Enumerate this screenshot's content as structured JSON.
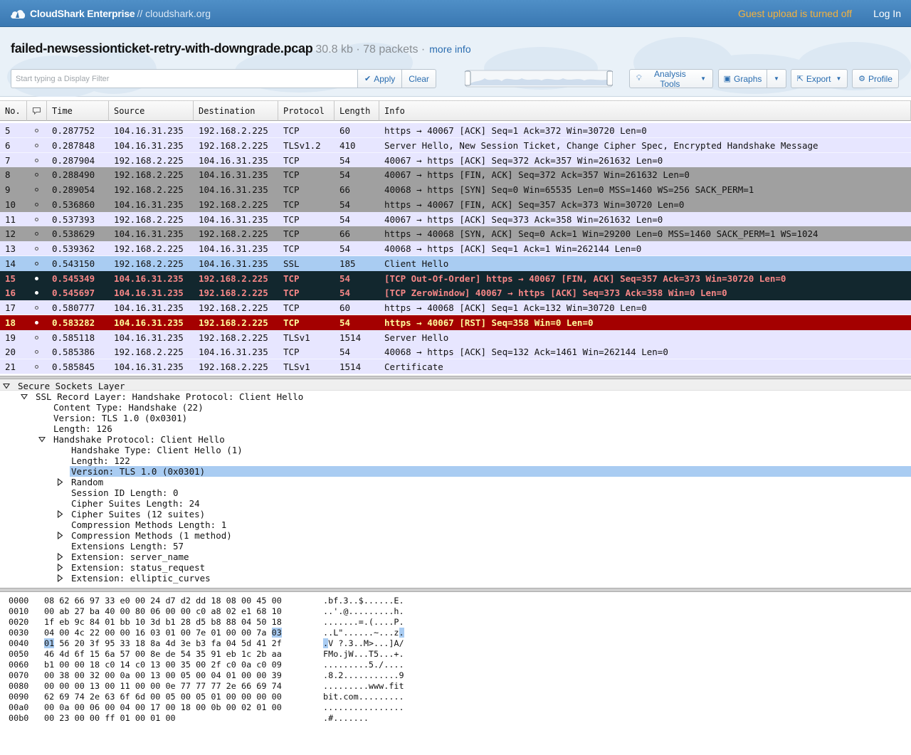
{
  "topnav": {
    "brand_name": "CloudShark Enterprise",
    "brand_suffix": "// cloudshark.org",
    "guest_note": "Guest upload is turned off",
    "login": "Log In",
    "logo_icon": "shark-cloud-icon",
    "accent_color": "#f4b23e"
  },
  "file": {
    "name": "failed-newsessionticket-retry-with-downgrade.pcap",
    "meta": "30.8 kb · 78 packets ·",
    "more_info": "more info"
  },
  "filter": {
    "placeholder": "Start typing a Display Filter",
    "value": "",
    "apply_label": "Apply",
    "clear_label": "Clear"
  },
  "tools": {
    "analysis_label": "Analysis Tools",
    "graphs_label": "Graphs",
    "export_label": "Export",
    "profile_label": "Profile"
  },
  "packet_list": {
    "columns": [
      "No.",
      "",
      "Time",
      "Source",
      "Destination",
      "Protocol",
      "Length",
      "Info"
    ],
    "rows": [
      {
        "no": "5",
        "time": "0.287752",
        "src": "104.16.31.235",
        "dst": "192.168.2.225",
        "proto": "TCP",
        "len": "60",
        "info": "https → 40067 [ACK] Seq=1 Ack=372 Win=30720 Len=0",
        "style": "tcp"
      },
      {
        "no": "6",
        "time": "0.287848",
        "src": "104.16.31.235",
        "dst": "192.168.2.225",
        "proto": "TLSv1.2",
        "len": "410",
        "info": "Server Hello, New Session Ticket, Change Cipher Spec, Encrypted Handshake Message",
        "style": "tcp"
      },
      {
        "no": "7",
        "time": "0.287904",
        "src": "192.168.2.225",
        "dst": "104.16.31.235",
        "proto": "TCP",
        "len": "54",
        "info": "40067 → https [ACK] Seq=372 Ack=357 Win=261632 Len=0",
        "style": "tcp"
      },
      {
        "no": "8",
        "time": "0.288490",
        "src": "192.168.2.225",
        "dst": "104.16.31.235",
        "proto": "TCP",
        "len": "54",
        "info": "40067 → https [FIN, ACK] Seq=372 Ack=357 Win=261632 Len=0",
        "style": "synfin"
      },
      {
        "no": "9",
        "time": "0.289054",
        "src": "192.168.2.225",
        "dst": "104.16.31.235",
        "proto": "TCP",
        "len": "66",
        "info": "40068 → https [SYN] Seq=0 Win=65535 Len=0 MSS=1460 WS=256 SACK_PERM=1",
        "style": "synfin"
      },
      {
        "no": "10",
        "time": "0.536860",
        "src": "104.16.31.235",
        "dst": "192.168.2.225",
        "proto": "TCP",
        "len": "54",
        "info": "https → 40067 [FIN, ACK] Seq=357 Ack=373 Win=30720 Len=0",
        "style": "synfin"
      },
      {
        "no": "11",
        "time": "0.537393",
        "src": "192.168.2.225",
        "dst": "104.16.31.235",
        "proto": "TCP",
        "len": "54",
        "info": "40067 → https [ACK] Seq=373 Ack=358 Win=261632 Len=0",
        "style": "tcp"
      },
      {
        "no": "12",
        "time": "0.538629",
        "src": "104.16.31.235",
        "dst": "192.168.2.225",
        "proto": "TCP",
        "len": "66",
        "info": "https → 40068 [SYN, ACK] Seq=0 Ack=1 Win=29200 Len=0 MSS=1460 SACK_PERM=1 WS=1024",
        "style": "synfin"
      },
      {
        "no": "13",
        "time": "0.539362",
        "src": "192.168.2.225",
        "dst": "104.16.31.235",
        "proto": "TCP",
        "len": "54",
        "info": "40068 → https [ACK] Seq=1 Ack=1 Win=262144 Len=0",
        "style": "tcp"
      },
      {
        "no": "14",
        "time": "0.543150",
        "src": "192.168.2.225",
        "dst": "104.16.31.235",
        "proto": "SSL",
        "len": "185",
        "info": "Client Hello",
        "style": "selected"
      },
      {
        "no": "15",
        "time": "0.545349",
        "src": "104.16.31.235",
        "dst": "192.168.2.225",
        "proto": "TCP",
        "len": "54",
        "info": "[TCP Out-Of-Order] https → 40067 [FIN, ACK] Seq=357 Ack=373 Win=30720 Len=0",
        "style": "bad"
      },
      {
        "no": "16",
        "time": "0.545697",
        "src": "104.16.31.235",
        "dst": "192.168.2.225",
        "proto": "TCP",
        "len": "54",
        "info": "[TCP ZeroWindow] 40067 → https [ACK] Seq=373 Ack=358 Win=0 Len=0",
        "style": "bad"
      },
      {
        "no": "17",
        "time": "0.580777",
        "src": "104.16.31.235",
        "dst": "192.168.2.225",
        "proto": "TCP",
        "len": "60",
        "info": "https → 40068 [ACK] Seq=1 Ack=132 Win=30720 Len=0",
        "style": "tcp"
      },
      {
        "no": "18",
        "time": "0.583282",
        "src": "104.16.31.235",
        "dst": "192.168.2.225",
        "proto": "TCP",
        "len": "54",
        "info": "https → 40067 [RST] Seq=358 Win=0 Len=0",
        "style": "rst"
      },
      {
        "no": "19",
        "time": "0.585118",
        "src": "104.16.31.235",
        "dst": "192.168.2.225",
        "proto": "TLSv1",
        "len": "1514",
        "info": "Server Hello",
        "style": "tcp"
      },
      {
        "no": "20",
        "time": "0.585386",
        "src": "192.168.2.225",
        "dst": "104.16.31.235",
        "proto": "TCP",
        "len": "54",
        "info": "40068 → https [ACK] Seq=132 Ack=1461 Win=262144 Len=0",
        "style": "tcp"
      },
      {
        "no": "21",
        "time": "0.585845",
        "src": "104.16.31.235",
        "dst": "192.168.2.225",
        "proto": "TLSv1",
        "len": "1514",
        "info": "Certificate",
        "style": "tcp"
      }
    ]
  },
  "details": {
    "lines": [
      {
        "level": 0,
        "toggle": "open",
        "text": "Secure Sockets Layer"
      },
      {
        "level": 1,
        "toggle": "open",
        "text": "SSL Record Layer: Handshake Protocol: Client Hello"
      },
      {
        "level": 2,
        "toggle": "none",
        "text": "Content Type: Handshake (22)"
      },
      {
        "level": 2,
        "toggle": "none",
        "text": "Version: TLS 1.0 (0x0301)"
      },
      {
        "level": 2,
        "toggle": "none",
        "text": "Length: 126"
      },
      {
        "level": 2,
        "toggle": "open",
        "text": "Handshake Protocol: Client Hello"
      },
      {
        "level": 3,
        "toggle": "none",
        "text": "Handshake Type: Client Hello (1)"
      },
      {
        "level": 3,
        "toggle": "none",
        "text": "Length: 122"
      },
      {
        "level": 3,
        "toggle": "none",
        "text": "Version: TLS 1.0 (0x0301)",
        "selected": true
      },
      {
        "level": 3,
        "toggle": "closed",
        "text": "Random"
      },
      {
        "level": 3,
        "toggle": "none",
        "text": "Session ID Length: 0"
      },
      {
        "level": 3,
        "toggle": "none",
        "text": "Cipher Suites Length: 24"
      },
      {
        "level": 3,
        "toggle": "closed",
        "text": "Cipher Suites (12 suites)"
      },
      {
        "level": 3,
        "toggle": "none",
        "text": "Compression Methods Length: 1"
      },
      {
        "level": 3,
        "toggle": "closed",
        "text": "Compression Methods (1 method)"
      },
      {
        "level": 3,
        "toggle": "none",
        "text": "Extensions Length: 57"
      },
      {
        "level": 3,
        "toggle": "closed",
        "text": "Extension: server_name"
      },
      {
        "level": 3,
        "toggle": "closed",
        "text": "Extension: status_request"
      },
      {
        "level": 3,
        "toggle": "closed",
        "text": "Extension: elliptic_curves"
      }
    ]
  },
  "hex": {
    "lines": [
      {
        "off": "0000",
        "bytes": "08 62 66 97 33 e0 00 24 d7 d2 dd 18 08 00 45 00",
        "ascii": ".bf.3..$......E."
      },
      {
        "off": "0010",
        "bytes": "00 ab 27 ba 40 00 80 06 00 00 c0 a8 02 e1 68 10",
        "ascii": "..'.@.........h."
      },
      {
        "off": "0020",
        "bytes": "1f eb 9c 84 01 bb 10 3d b1 28 d5 b8 88 04 50 18",
        "ascii": ".......=.(....P."
      },
      {
        "off": "0030",
        "bytes": "04 00 4c 22 00 00 16 03 01 00 7e 01 00 00 7a 03",
        "ascii": "..L\"......~...z."
      },
      {
        "off": "0040",
        "bytes": "01 56 20 3f 95 33 18 8a 4d 3e b3 fa 04 5d 41 2f",
        "ascii": ".V ?.3..M>...]A/"
      },
      {
        "off": "0050",
        "bytes": "46 4d 6f 15 6a 57 00 8e de 54 35 91 eb 1c 2b aa",
        "ascii": "FMo.jW...T5...+."
      },
      {
        "off": "0060",
        "bytes": "b1 00 00 18 c0 14 c0 13 00 35 00 2f c0 0a c0 09",
        "ascii": ".........5./...."
      },
      {
        "off": "0070",
        "bytes": "00 38 00 32 00 0a 00 13 00 05 00 04 01 00 00 39",
        "ascii": ".8.2...........9"
      },
      {
        "off": "0080",
        "bytes": "00 00 00 13 00 11 00 00 0e 77 77 77 2e 66 69 74",
        "ascii": ".........www.fit"
      },
      {
        "off": "0090",
        "bytes": "62 69 74 2e 63 6f 6d 00 05 00 05 01 00 00 00 00",
        "ascii": "bit.com........."
      },
      {
        "off": "00a0",
        "bytes": "00 0a 00 06 00 04 00 17 00 18 00 0b 00 02 01 00",
        "ascii": "................"
      },
      {
        "off": "00b0",
        "bytes": "00 23 00 00 ff 01 00 01 00",
        "ascii": ".#......."
      }
    ]
  },
  "colors": {
    "nav": "#3f80bb",
    "tcp_row": "#e7e6ff",
    "synfin_row": "#a0a0a0",
    "selected_row": "#a9ccf2",
    "bad_row_bg": "#12272e",
    "bad_row_fg": "#f78787",
    "rst_row_bg": "#a40000",
    "rst_row_fg": "#fffc9c"
  }
}
